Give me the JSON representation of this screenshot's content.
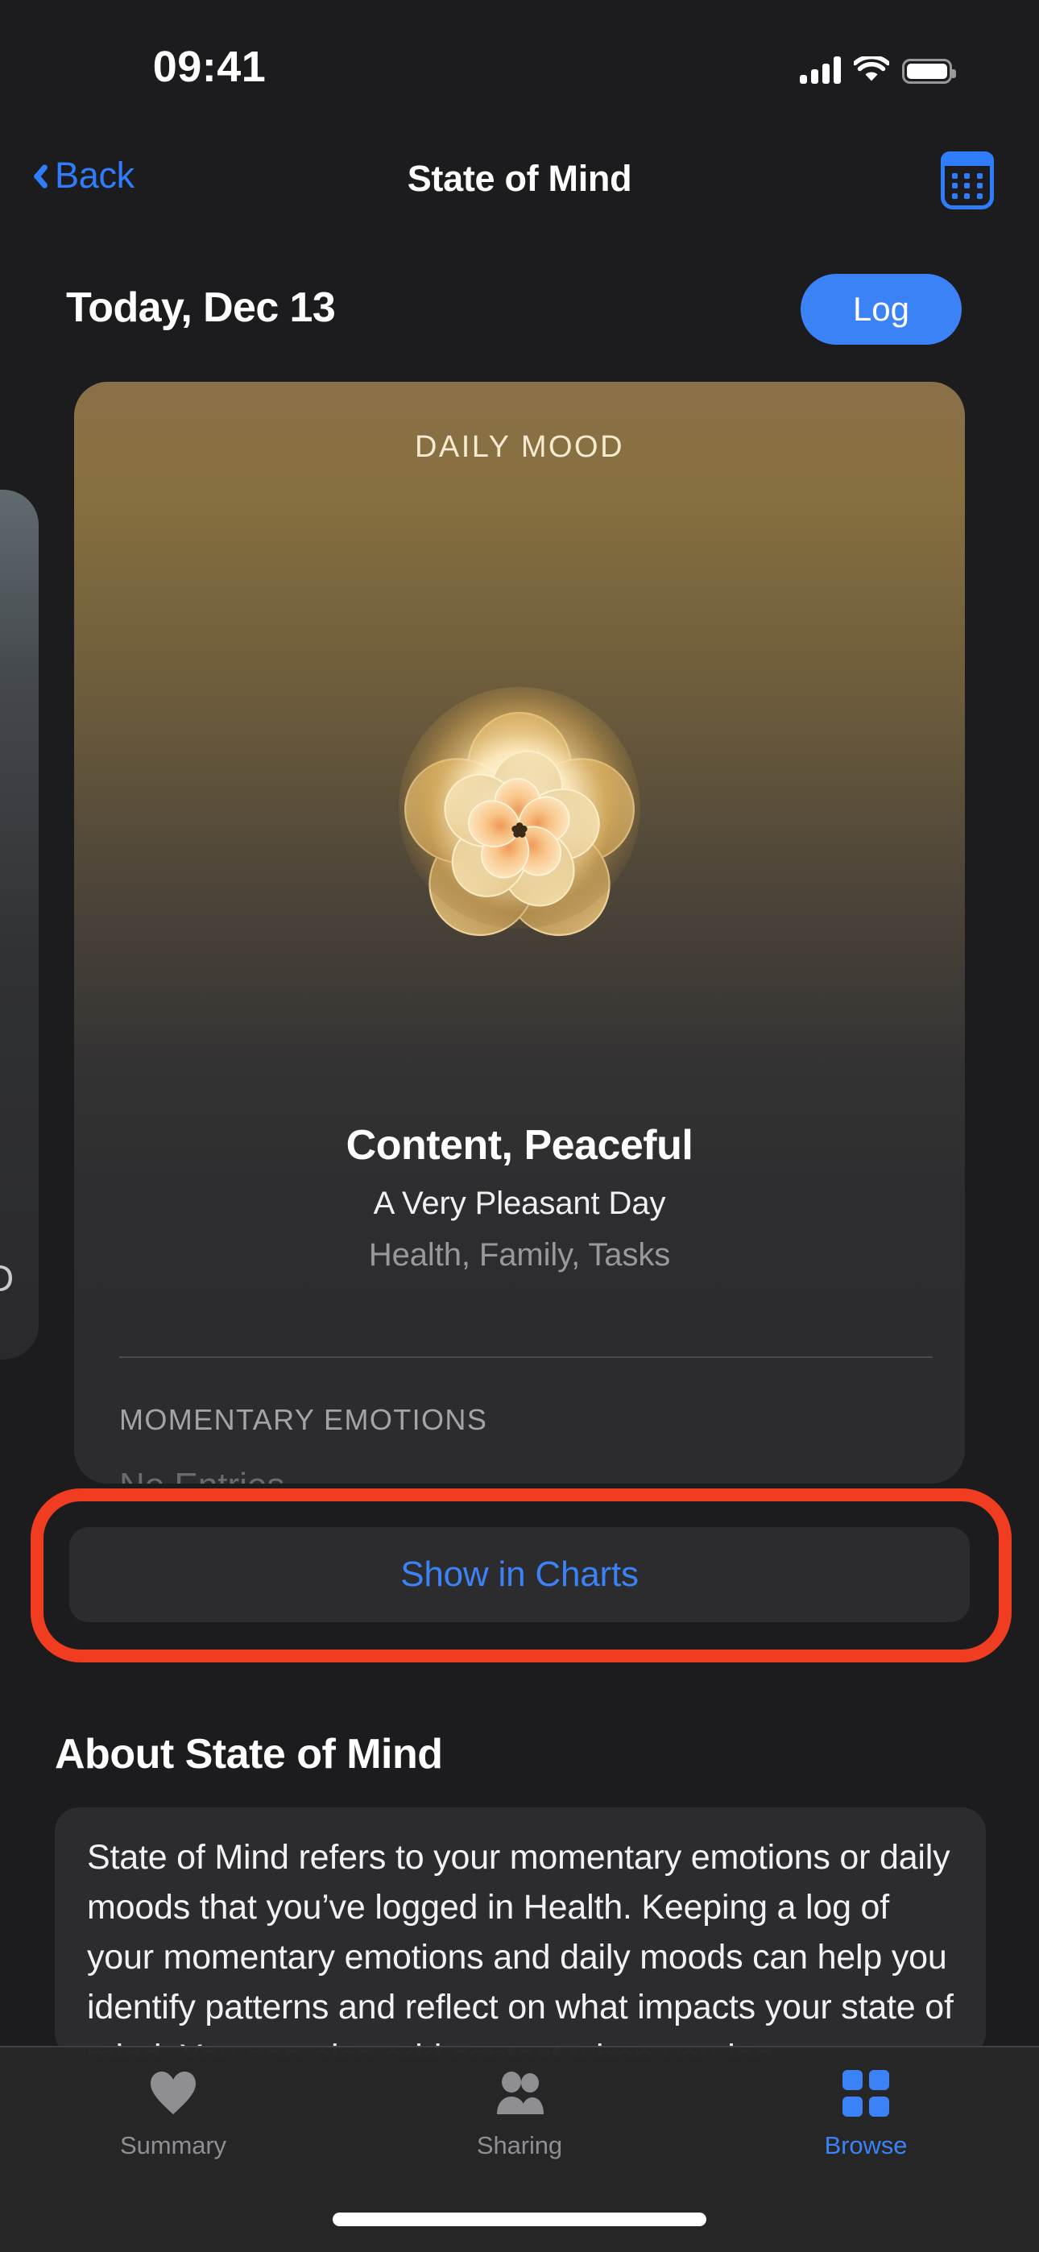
{
  "status_bar": {
    "time": "09:41",
    "signal_icon": "cellular-signal-icon",
    "wifi_icon": "wifi-icon",
    "battery_icon": "battery-full-icon"
  },
  "nav_bar": {
    "back_label": "Back",
    "title": "State of Mind",
    "calendar_icon": "calendar-icon",
    "accent_color": "#2f7dfb"
  },
  "today_row": {
    "date_label": "Today, Dec 13",
    "log_button_label": "Log",
    "log_button_color": "#3b82f6"
  },
  "mood_card": {
    "kicker": "DAILY MOOD",
    "flower_icon": "state-of-mind-flower-icon",
    "title": "Content, Peaceful",
    "subtitle": "A Very Pleasant Day",
    "context": "Health, Family, Tasks",
    "gradient_top_color": "#8a7048",
    "gradient_bottom_color": "#2c2c2e",
    "momentary_emotions_title": "MOMENTARY EMOTIONS",
    "momentary_emotions_empty": "No Entries"
  },
  "peek_card": {
    "clipped_glyph": "D"
  },
  "show_in_charts": {
    "label": "Show in Charts",
    "text_color": "#3b82f6",
    "annotation_color": "#f03c20"
  },
  "about": {
    "heading": "About State of Mind",
    "body": "State of Mind refers to your momentary emotions or daily moods that you’ve logged in Health. Keeping a log of your momentary emotions and daily moods can help you identify patterns and reflect on what impacts your state of mind. You can also add context when you log"
  },
  "tab_bar": {
    "items": [
      {
        "label": "Summary",
        "icon": "heart-icon",
        "active": false
      },
      {
        "label": "Sharing",
        "icon": "people-icon",
        "active": false
      },
      {
        "label": "Browse",
        "icon": "grid-squares-icon",
        "active": true
      }
    ],
    "active_color": "#3b82f6",
    "inactive_color": "#8e8e93"
  }
}
